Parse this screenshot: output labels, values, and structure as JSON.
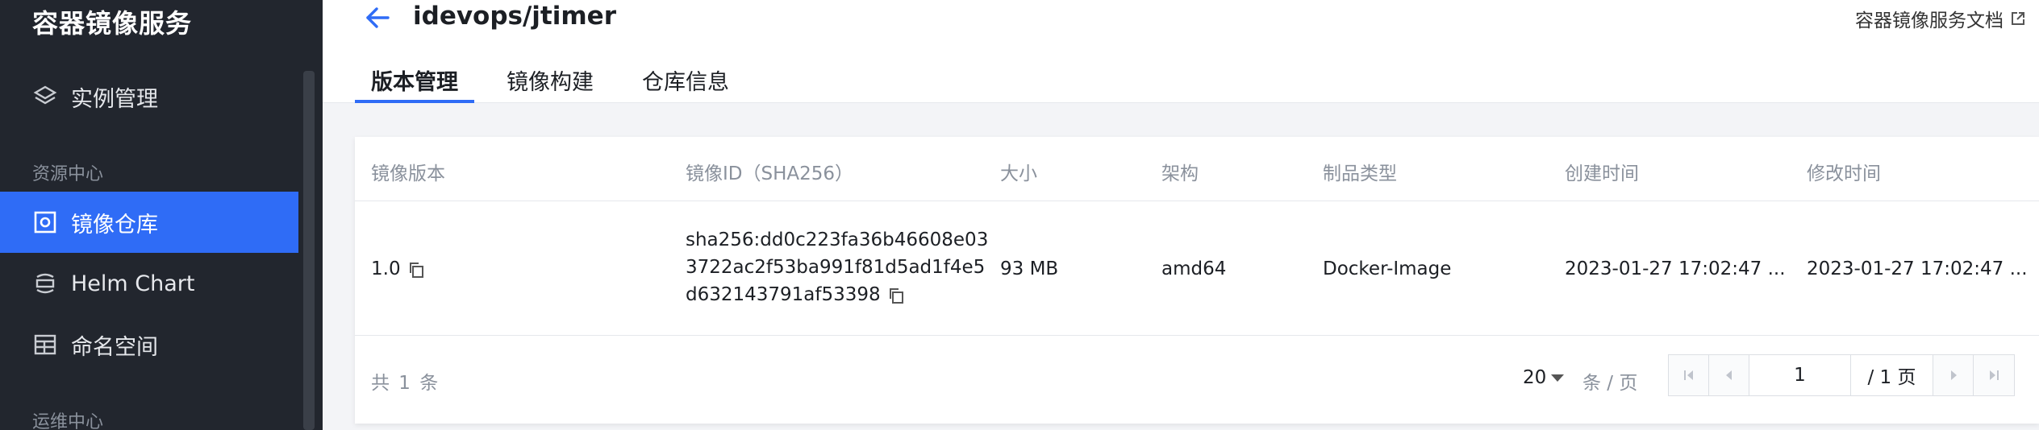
{
  "sidebar": {
    "title": "容器镜像服务",
    "items": [
      {
        "label": "实例管理"
      },
      {
        "label": "镜像仓库"
      },
      {
        "label": "Helm Chart"
      },
      {
        "label": "命名空间"
      }
    ],
    "sections": [
      {
        "label": "资源中心"
      },
      {
        "label": "运维中心"
      }
    ]
  },
  "header": {
    "title": "idevops/jtimer",
    "doc_link": "容器镜像服务文档",
    "tabs": [
      {
        "label": "版本管理"
      },
      {
        "label": "镜像构建"
      },
      {
        "label": "仓库信息"
      }
    ]
  },
  "table": {
    "columns": [
      "镜像版本",
      "镜像ID（SHA256）",
      "大小",
      "架构",
      "制品类型",
      "创建时间",
      "修改时间"
    ],
    "rows": [
      {
        "version": "1.0",
        "sha": "sha256:dd0c223fa36b46608e033722ac2f53ba991f81d5ad1f4e5d632143791af53398",
        "size": "93 MB",
        "arch": "amd64",
        "type": "Docker-Image",
        "created": "2023-01-27 17:02:47 ...",
        "modified": "2023-01-27 17:02:47 ..."
      }
    ]
  },
  "pagination": {
    "total_text": "共 1 条",
    "page_size": "20",
    "per_page_unit": "条 / 页",
    "current_page": "1",
    "total_pages": "/ 1 页"
  },
  "colors": {
    "accent": "#2f6cf6",
    "sidebar_bg": "#22262e"
  }
}
